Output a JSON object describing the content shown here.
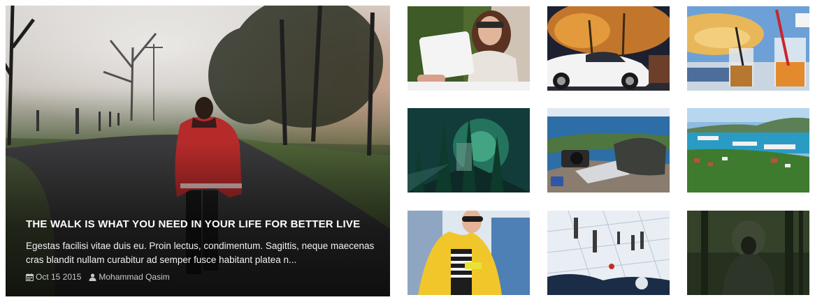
{
  "featured": {
    "title": "THE WALK IS WHAT YOU NEED IN YOUR LIFE FOR BETTER LIVE",
    "excerpt": "Egestas facilisi vitae duis eu. Proin lectus, condimentum. Sagittis, neque maecenas cras blandit nullam curabitur ad semper fusce habitant platea n...",
    "date": "Oct 15 2015",
    "author": "Mohammad Qasim",
    "date_icon": "calendar-icon",
    "author_icon": "user-icon",
    "image_icon": "man-walking-road-photo"
  },
  "thumbnails": [
    {
      "image": "woman-with-tablet-photo"
    },
    {
      "image": "white-sports-car-palms-photo"
    },
    {
      "image": "cocktail-drinks-beach-photo"
    },
    {
      "image": "fantasy-forest-illustration"
    },
    {
      "image": "camera-laptop-coast-photo"
    },
    {
      "image": "cruise-ships-harbor-photo"
    },
    {
      "image": "woman-yellow-jacket-phone-photo"
    },
    {
      "image": "miniature-game-board-photo"
    },
    {
      "image": "hooded-figure-forest-photo"
    }
  ]
}
